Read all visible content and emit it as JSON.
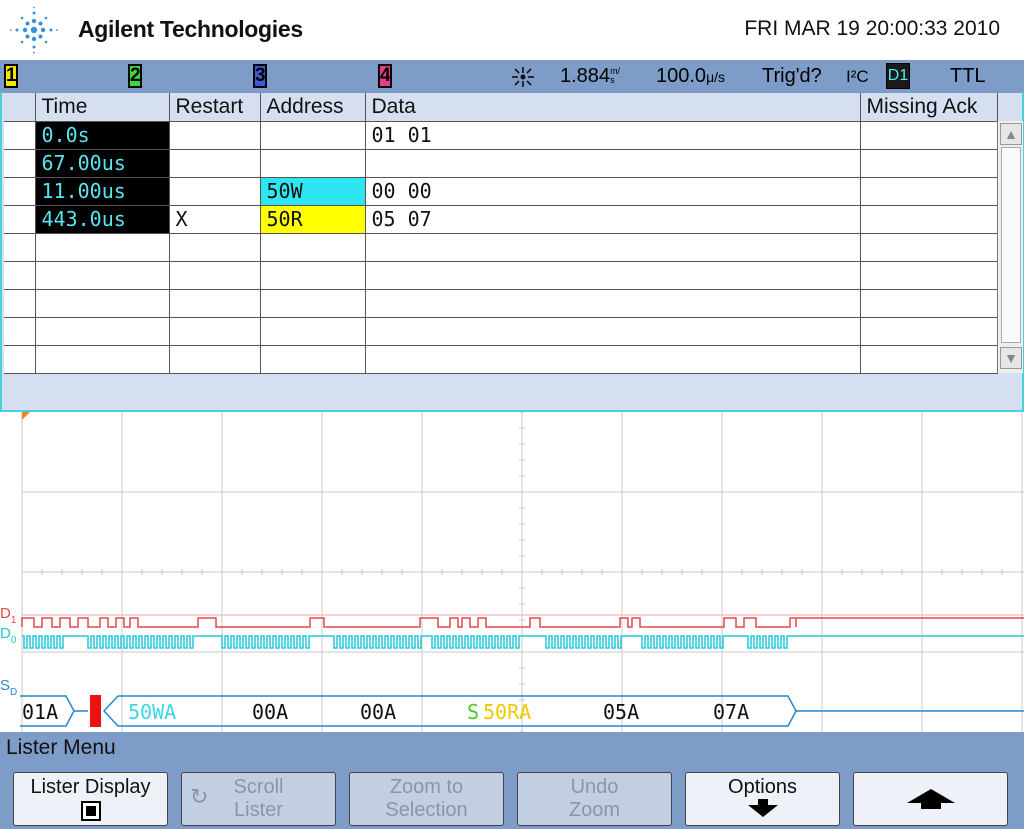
{
  "header": {
    "brand": "Agilent Technologies",
    "datetime": "FRI MAR 19 20:00:33 2010"
  },
  "status": {
    "channels": [
      "1",
      "2",
      "3",
      "4"
    ],
    "channel_colors": [
      "#f3e600",
      "#3cd83c",
      "#3a5cd8",
      "#e83c8c"
    ],
    "trigger_level": "1.884",
    "trigger_level_unit": "m/s",
    "timebase": "100.0",
    "timebase_unit": "μ/s",
    "trig_status": "Trig'd?",
    "protocol": "I²C",
    "trigger_source": "D1",
    "logic_threshold": "TTL"
  },
  "lister": {
    "columns": [
      "Time",
      "Restart",
      "Address",
      "Data",
      "Missing Ack"
    ],
    "rows": [
      {
        "time": "0.0s",
        "restart": "",
        "address": "",
        "data": "01 01",
        "missing_ack": "",
        "addr_hl": ""
      },
      {
        "time": "67.00us",
        "restart": "",
        "address": "",
        "data": "",
        "missing_ack": "",
        "addr_hl": ""
      },
      {
        "time": "11.00us",
        "restart": "",
        "address": "50W",
        "data": "00 00",
        "missing_ack": "",
        "addr_hl": "cyan"
      },
      {
        "time": "443.0us",
        "restart": "X",
        "address": "50R",
        "data": "05 07",
        "missing_ack": "",
        "addr_hl": "yellow"
      },
      {
        "time": "",
        "restart": "",
        "address": "",
        "data": "",
        "missing_ack": "",
        "addr_hl": ""
      },
      {
        "time": "",
        "restart": "",
        "address": "",
        "data": "",
        "missing_ack": "",
        "addr_hl": ""
      },
      {
        "time": "",
        "restart": "",
        "address": "",
        "data": "",
        "missing_ack": "",
        "addr_hl": ""
      },
      {
        "time": "",
        "restart": "",
        "address": "",
        "data": "",
        "missing_ack": "",
        "addr_hl": ""
      },
      {
        "time": "",
        "restart": "",
        "address": "",
        "data": "",
        "missing_ack": "",
        "addr_hl": ""
      }
    ]
  },
  "waveform": {
    "d1_label": "D1",
    "d0_label": "D0",
    "sd_label": "SD",
    "trace_colors": {
      "d1": "#e04848",
      "d0": "#22c8d8",
      "bus": "#2288cc"
    },
    "decode": [
      {
        "text": "01A",
        "color": "#111111"
      },
      {
        "text": "50WA",
        "color": "#3ed6e6"
      },
      {
        "text": "00A",
        "color": "#111111"
      },
      {
        "text": "00A",
        "color": "#111111"
      },
      {
        "text": "S",
        "color": "#44cc22"
      },
      {
        "text": "50RA",
        "color": "#f0c800"
      },
      {
        "text": "05A",
        "color": "#111111"
      },
      {
        "text": "07A",
        "color": "#111111"
      }
    ]
  },
  "menu": {
    "title": "Lister Menu",
    "buttons": [
      {
        "line1": "Lister Display",
        "line2": "",
        "enabled": true
      },
      {
        "line1": "Scroll",
        "line2": "Lister",
        "enabled": false
      },
      {
        "line1": "Zoom to",
        "line2": "Selection",
        "enabled": false
      },
      {
        "line1": "Undo",
        "line2": "Zoom",
        "enabled": false
      },
      {
        "line1": "Options",
        "line2": "",
        "enabled": true
      },
      {
        "line1": "",
        "line2": "",
        "enabled": true
      }
    ]
  }
}
